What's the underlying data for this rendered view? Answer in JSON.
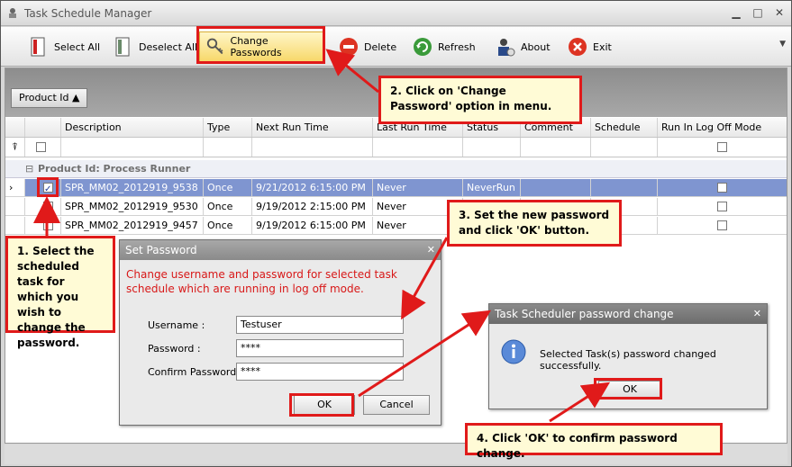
{
  "window": {
    "title": "Task Schedule Manager"
  },
  "toolbar": {
    "select_all": "Select All",
    "deselect_all": "Deselect All",
    "change_passwords": "Change Passwords",
    "delete": "Delete",
    "refresh": "Refresh",
    "about": "About",
    "exit": "Exit"
  },
  "group": {
    "chip_label": "Product Id ▲",
    "row_label": "Product Id: Process Runner"
  },
  "grid": {
    "columns": [
      "Description",
      "Type",
      "Next Run Time",
      "Last Run Time",
      "Status",
      "Comment",
      "Schedule",
      "Run In Log Off Mode"
    ],
    "rows": [
      {
        "description": "SPR_MM02_2012919_9538",
        "type": "Once",
        "next_run": "9/21/2012 6:15:00 PM",
        "last_run": "Never",
        "status": "NeverRun",
        "checked": true
      },
      {
        "description": "SPR_MM02_2012919_9530",
        "type": "Once",
        "next_run": "9/19/2012 2:15:00 PM",
        "last_run": "Never",
        "status": "",
        "checked": false
      },
      {
        "description": "SPR_MM02_2012919_9457",
        "type": "Once",
        "next_run": "9/19/2012 6:15:00 PM",
        "last_run": "Never",
        "status": "",
        "checked": false
      }
    ]
  },
  "set_password": {
    "title": "Set Password",
    "message": "Change username and password for selected task schedule which are running in log off mode.",
    "username_label": "Username :",
    "username_value": "Testuser",
    "password_label": "Password :",
    "password_value": "****",
    "confirm_label": "Confirm Password :",
    "confirm_value": "****",
    "ok": "OK",
    "cancel": "Cancel"
  },
  "confirm_dialog": {
    "title": "Task Scheduler password change",
    "message": "Selected Task(s)  password changed successfully.",
    "ok": "OK"
  },
  "callouts": {
    "c1": "1. Select the scheduled task for which you wish to change the password.",
    "c2": "2. Click on 'Change Password' option in menu.",
    "c3": "3. Set the new password and click 'OK' button.",
    "c4": "4. Click 'OK' to confirm password change."
  },
  "colors": {
    "annotation": "#e01a1a",
    "selected_row": "#7f95d0",
    "callout_bg": "#fffbd6"
  }
}
